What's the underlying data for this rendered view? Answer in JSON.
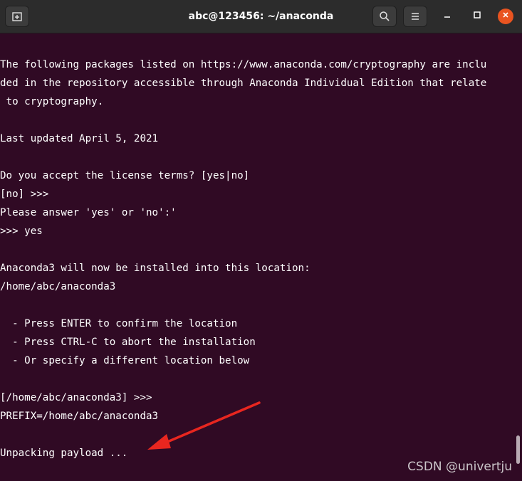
{
  "window": {
    "title": "abc@123456: ~/anaconda"
  },
  "titlebar": {
    "new_tab_icon": "new-tab-icon",
    "search_icon": "search-icon",
    "menu_icon": "hamburger-menu-icon",
    "minimize_icon": "minimize-icon",
    "maximize_icon": "maximize-icon",
    "close_icon": "close-icon",
    "close_color": "#e95420"
  },
  "terminal": {
    "background": "#300a24",
    "lines": [
      "The following packages listed on https://www.anaconda.com/cryptography are inclu",
      "ded in the repository accessible through Anaconda Individual Edition that relate",
      " to cryptography.",
      "",
      "Last updated April 5, 2021",
      "",
      "Do you accept the license terms? [yes|no]",
      "[no] >>>",
      "Please answer 'yes' or 'no':'",
      ">>> yes",
      "",
      "Anaconda3 will now be installed into this location:",
      "/home/abc/anaconda3",
      "",
      "  - Press ENTER to confirm the location",
      "  - Press CTRL-C to abort the installation",
      "  - Or specify a different location below",
      "",
      "[/home/abc/anaconda3] >>>",
      "PREFIX=/home/abc/anaconda3",
      "",
      "Unpacking payload ..."
    ]
  },
  "annotation": {
    "arrow_color": "#e8261f"
  },
  "watermark": "CSDN @univertju"
}
